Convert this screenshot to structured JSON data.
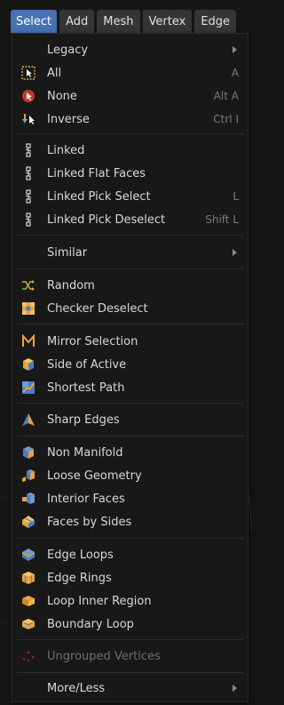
{
  "menubar": {
    "tabs": [
      "Select",
      "Add",
      "Mesh",
      "Vertex",
      "Edge"
    ]
  },
  "menu": {
    "legacy": "Legacy",
    "all": "All",
    "all_shortcut": "A",
    "none": "None",
    "none_shortcut": "Alt A",
    "inverse": "Inverse",
    "inverse_shortcut": "Ctrl I",
    "linked": "Linked",
    "linked_flat_faces": "Linked Flat Faces",
    "linked_pick_select": "Linked Pick Select",
    "linked_pick_select_shortcut": "L",
    "linked_pick_deselect": "Linked Pick Deselect",
    "linked_pick_deselect_shortcut": "Shift L",
    "similar": "Similar",
    "random": "Random",
    "checker_deselect": "Checker Deselect",
    "mirror_selection": "Mirror Selection",
    "side_of_active": "Side of Active",
    "shortest_path": "Shortest Path",
    "sharp_edges": "Sharp Edges",
    "non_manifold": "Non Manifold",
    "loose_geometry": "Loose Geometry",
    "interior_faces": "Interior Faces",
    "faces_by_sides": "Faces by Sides",
    "edge_loops": "Edge Loops",
    "edge_rings": "Edge Rings",
    "loop_inner_region": "Loop Inner Region",
    "boundary_loop": "Boundary Loop",
    "ungrouped_vertices": "Ungrouped Vertices",
    "more_less": "More/Less"
  },
  "colors": {
    "accent": "#4772b3",
    "menu_bg": "#181818",
    "text": "#d8d8d8",
    "shortcut": "#7a7a7a",
    "disabled": "#6e6e6e"
  }
}
